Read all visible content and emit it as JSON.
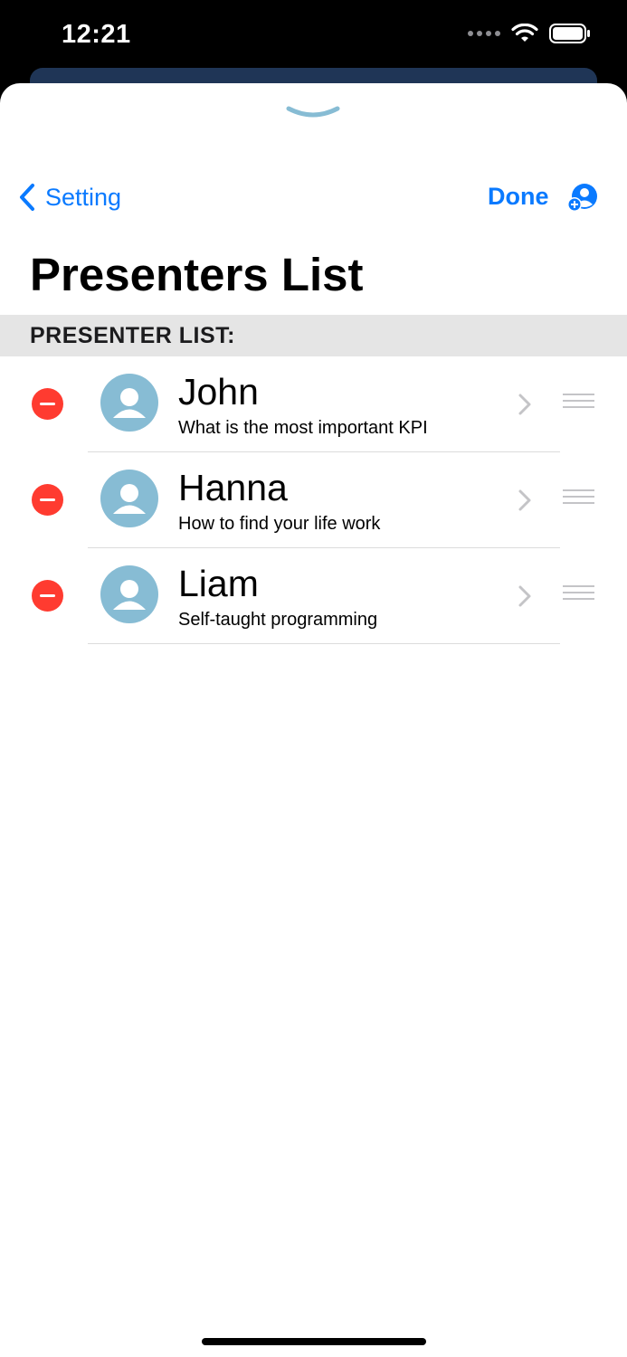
{
  "status_bar": {
    "time": "12:21"
  },
  "nav": {
    "back_label": "Setting",
    "done_label": "Done"
  },
  "page": {
    "title": "Presenters List"
  },
  "section": {
    "header": "PRESENTER LIST:"
  },
  "presenters": [
    {
      "name": "John",
      "topic": "What is the most important KPI"
    },
    {
      "name": "Hanna",
      "topic": "How to find your life work"
    },
    {
      "name": "Liam",
      "topic": "Self-taught programming"
    }
  ],
  "icons": {
    "grabber": "chevron-down-icon",
    "back": "chevron-left-icon",
    "add_user": "person-add-icon",
    "delete": "minus-circle-icon",
    "disclosure": "chevron-right-icon",
    "reorder": "reorder-grip-icon"
  },
  "colors": {
    "accent": "#0a7aff",
    "delete": "#ff3b30",
    "avatar": "#87bcd4",
    "section_bg": "#e5e5e5"
  }
}
